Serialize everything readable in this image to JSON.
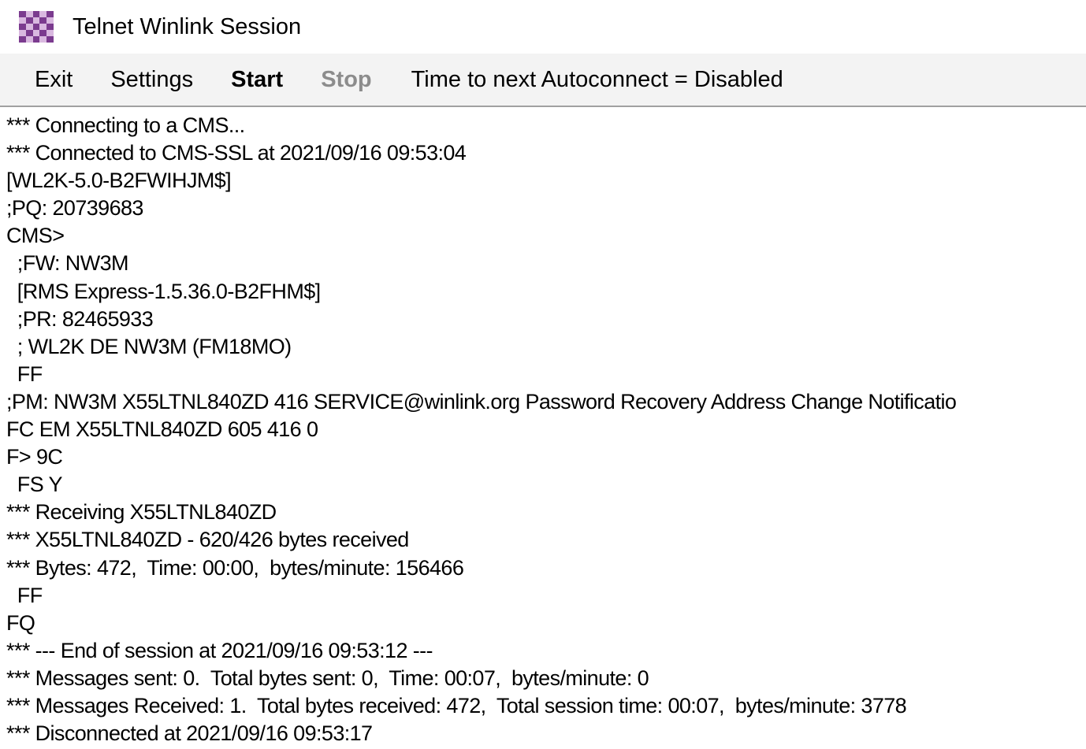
{
  "window": {
    "title": "Telnet Winlink Session",
    "icon": "winlink-checker-icon"
  },
  "menu": {
    "exit": "Exit",
    "settings": "Settings",
    "start": "Start",
    "stop": "Stop",
    "autoconnect_status": "Time to next Autoconnect = Disabled"
  },
  "log": {
    "lines": [
      "*** Connecting to a CMS...",
      "*** Connected to CMS-SSL at 2021/09/16 09:53:04",
      "[WL2K-5.0-B2FWIHJM$]",
      ";PQ: 20739683",
      "CMS>",
      "  ;FW: NW3M",
      "  [RMS Express-1.5.36.0-B2FHM$]",
      "  ;PR: 82465933",
      "  ; WL2K DE NW3M (FM18MO)",
      "  FF",
      ";PM: NW3M X55LTNL840ZD 416 SERVICE@winlink.org Password Recovery Address Change Notificatio",
      "FC EM X55LTNL840ZD 605 416 0",
      "F> 9C",
      "  FS Y",
      "*** Receiving X55LTNL840ZD",
      "*** X55LTNL840ZD - 620/426 bytes received",
      "*** Bytes: 472,  Time: 00:00,  bytes/minute: 156466",
      "  FF",
      "FQ",
      "*** --- End of session at 2021/09/16 09:53:12 ---",
      "*** Messages sent: 0.  Total bytes sent: 0,  Time: 00:07,  bytes/minute: 0",
      "*** Messages Received: 1.  Total bytes received: 472,  Total session time: 00:07,  bytes/minute: 3778",
      "*** Disconnected at 2021/09/16 09:53:17"
    ]
  }
}
